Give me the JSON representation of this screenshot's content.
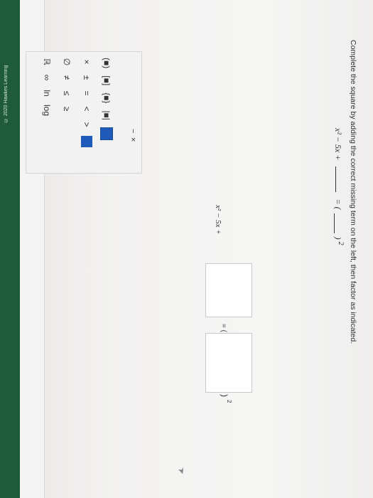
{
  "copyright": "© 2020 Hawkes Learning",
  "question": "Complete the square by adding the correct missing term on the left, then factor as indicated.",
  "top_equation": {
    "left": "x² − 5x +",
    "equals": "=",
    "open_paren": "(",
    "close_paren": ")",
    "exp": "2"
  },
  "work_equation": {
    "left": "x² − 5x +",
    "equals": "= (",
    "close_paren": ")",
    "exp": "2"
  },
  "toolbar": {
    "close": "×",
    "minus": "−",
    "row2": [
      "(■)",
      "[■]",
      "{■}",
      "|■|"
    ],
    "row3": [
      "×",
      "±",
      "=",
      "<",
      ">"
    ],
    "row4": [
      "∅",
      "≠",
      "≤",
      "≥"
    ],
    "row5": [
      "ℝ",
      "∞",
      "ln",
      "log"
    ]
  },
  "colors": {
    "accent": "#1f5ab8",
    "brand": "#1f5a3b"
  }
}
